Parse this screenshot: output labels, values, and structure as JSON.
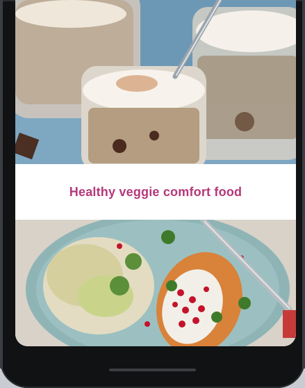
{
  "feed": {
    "items": [
      {
        "image_icon": "overnight-oats-photo-icon",
        "caption": ""
      },
      {
        "image_icon": "veggie-sweet-potato-photo-icon",
        "caption": "Healthy veggie comfort food"
      }
    ]
  },
  "colors": {
    "caption": "#b5387a",
    "device": "#111214"
  }
}
